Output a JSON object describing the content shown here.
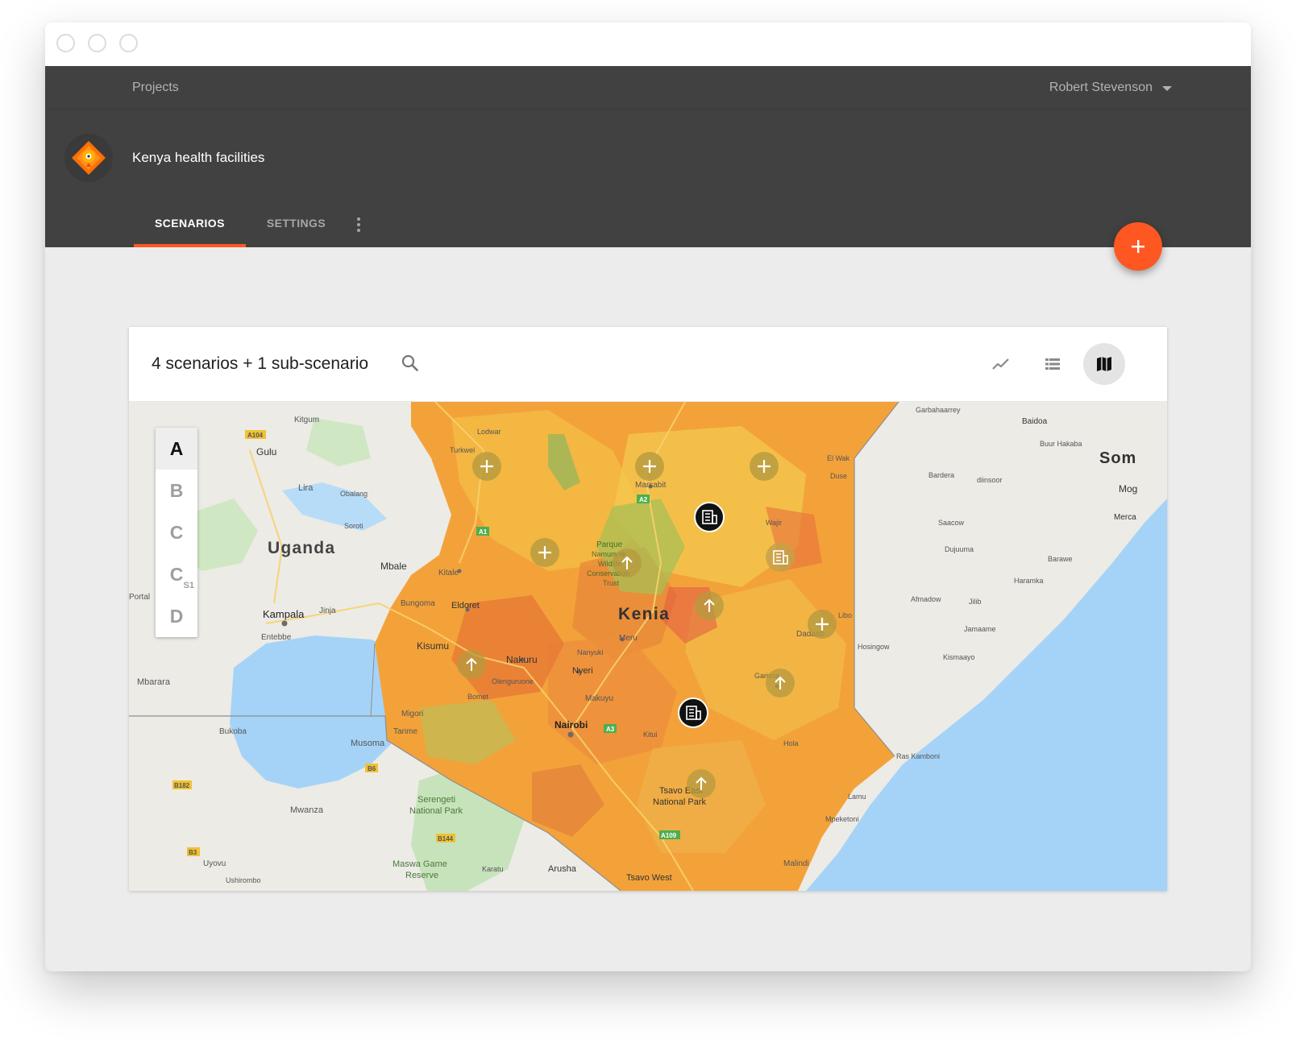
{
  "window": {
    "controls": [
      "close",
      "minimize",
      "maximize"
    ]
  },
  "nav": {
    "projects_label": "Projects",
    "user_name": "Robert Stevenson"
  },
  "project": {
    "title": "Kenya health facilities",
    "logo_icon": "diamond-location-icon"
  },
  "tabs": [
    {
      "label": "SCENARIOS",
      "active": true
    },
    {
      "label": "SETTINGS",
      "active": false
    }
  ],
  "fab": {
    "icon": "plus-icon"
  },
  "card": {
    "title": "4 scenarios + 1 sub-scenario",
    "views": [
      {
        "icon": "trend-line-icon",
        "active": false
      },
      {
        "icon": "list-view-icon",
        "active": false
      },
      {
        "icon": "map-view-icon",
        "active": true
      }
    ]
  },
  "scenarios": [
    {
      "label": "A",
      "sub": "",
      "active": true
    },
    {
      "label": "B",
      "sub": "",
      "active": false
    },
    {
      "label": "C",
      "sub": "",
      "active": false
    },
    {
      "label": "C",
      "sub": "S1",
      "active": false
    },
    {
      "label": "D",
      "sub": "",
      "active": false
    }
  ],
  "map": {
    "countries": {
      "uganda": "Uganda",
      "kenya": "Kenia",
      "somalia": "Som"
    },
    "places": {
      "kitgum": "Kitgum",
      "gulu": "Gulu",
      "lira": "Lira",
      "obalang": "Obalang",
      "soroti": "Soroti",
      "mbale": "Mbale",
      "kampala": "Kampala",
      "jinja": "Jinja",
      "entebbe": "Entebbe",
      "mbarara": "Mbarara",
      "portal": "Portal",
      "bukoba": "Bukoba",
      "musoma": "Musoma",
      "mwanza": "Mwanza",
      "uyovu": "Uyovu",
      "ushirombo": "Ushirombo",
      "serengeti": "Serengeti",
      "serengeti_np": "National Park",
      "maswa": "Maswa Game",
      "maswa_r": "Reserve",
      "karatu": "Karatu",
      "arusha": "Arusha",
      "lodwar": "Lodwar",
      "turkwel": "Turkwel",
      "kitale": "Kitale",
      "eldoret": "Eldoret",
      "bungoma": "Bungoma",
      "kisumu": "Kisumu",
      "nakuru": "Nakuru",
      "nyeri": "Nyeri",
      "nanyuki": "Nanyuki",
      "meru": "Meru",
      "makuyu": "Makuyu",
      "nairobi": "Nairobi",
      "kitui": "Kitui",
      "migori": "Migori",
      "tarime": "Tarime",
      "marsabit": "Marsabit",
      "wajir": "Wajir",
      "elwak": "El Wak",
      "dadaab": "Dadaab",
      "garissa": "Garissa",
      "hola": "Hola",
      "lamu": "Lamu",
      "malindi": "Malindi",
      "mpeketoni": "Mpeketoni",
      "tsavo_east": "Tsavo East",
      "tsavo_east_np": "National Park",
      "tsavo_west": "Tsavo West",
      "parque": "Parque",
      "namunyak": "Namunyak",
      "wildlife": "Wildlife",
      "conservation": "Conservation",
      "trust": "Trust",
      "olenguruone": "Olenguruone",
      "bomet": "Bomet",
      "garbahaarrey": "Garbahaarrey",
      "baidoa": "Baidoa",
      "buur_hakaba": "Buur Hakaba",
      "bardera": "Bardera",
      "diinsoor": "diinsoor",
      "mogadishu": "Mog",
      "merca": "Merca",
      "saacow": "Saacow",
      "dujuuma": "Dujuuma",
      "barawe": "Barawe",
      "haramka": "Haramka",
      "afmadow": "Afmadow",
      "jilib": "Jilib",
      "jamaame": "Jamaame",
      "kismaayo": "Kismaayo",
      "hosingow": "Hosingow",
      "ras_kamboni": "Ras Kamboni",
      "libo": "Libo",
      "duse": "Duse"
    },
    "roads": [
      "A104",
      "A1",
      "A2",
      "A3",
      "B6",
      "B144",
      "B182",
      "B3",
      "A109"
    ],
    "markers": [
      {
        "type": "plus",
        "name": "turkwel-plus-marker"
      },
      {
        "type": "plus",
        "name": "marsabit-plus-marker"
      },
      {
        "type": "plus",
        "name": "elwak-plus-marker"
      },
      {
        "type": "plus",
        "name": "west-plus-marker"
      },
      {
        "type": "plus",
        "name": "dadaab-plus-marker"
      },
      {
        "type": "upgrade",
        "name": "namunyak-upgrade-marker"
      },
      {
        "type": "upgrade",
        "name": "meru-upgrade-marker"
      },
      {
        "type": "upgrade",
        "name": "kisumu-upgrade-marker"
      },
      {
        "type": "upgrade",
        "name": "garissa-upgrade-marker"
      },
      {
        "type": "upgrade",
        "name": "tsavo-upgrade-marker"
      },
      {
        "type": "facility",
        "name": "marsabit-facility-marker"
      },
      {
        "type": "facility",
        "name": "nairobi-facility-marker"
      },
      {
        "type": "facility-muted",
        "name": "wajir-facility-marker"
      }
    ]
  }
}
